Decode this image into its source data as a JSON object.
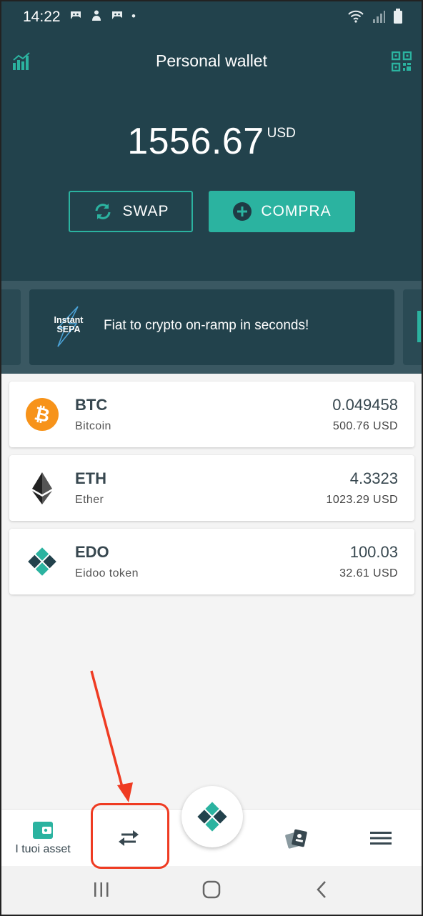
{
  "status_bar": {
    "time": "14:22",
    "dot": "•",
    "notification_icons": [
      "discord-icon",
      "person-icon",
      "discord-icon"
    ],
    "right_icons": [
      "wifi-icon",
      "signal-icon",
      "battery-icon"
    ]
  },
  "header": {
    "title": "Personal wallet",
    "balance_amount": "1556.67",
    "balance_currency": "USD",
    "swap_label": "SWAP",
    "buy_label": "COMPRA",
    "accent_color": "#2bb3a0",
    "background_color": "#22424c"
  },
  "banner": {
    "logo_line1": "Instant",
    "logo_line2": "SEPA",
    "text": "Fiat to crypto on-ramp in seconds!"
  },
  "assets": [
    {
      "symbol": "BTC",
      "name": "Bitcoin",
      "amount": "0.049458",
      "usd": "500.76 USD",
      "icon": "bitcoin-icon"
    },
    {
      "symbol": "ETH",
      "name": "Ether",
      "amount": "4.3323",
      "usd": "1023.29 USD",
      "icon": "ethereum-icon"
    },
    {
      "symbol": "EDO",
      "name": "Eidoo token",
      "amount": "100.03",
      "usd": "32.61 USD",
      "icon": "eidoo-icon"
    }
  ],
  "bottom_nav": {
    "assets_label": "I tuoi asset"
  },
  "annotation": {
    "color": "#ef3b22"
  }
}
